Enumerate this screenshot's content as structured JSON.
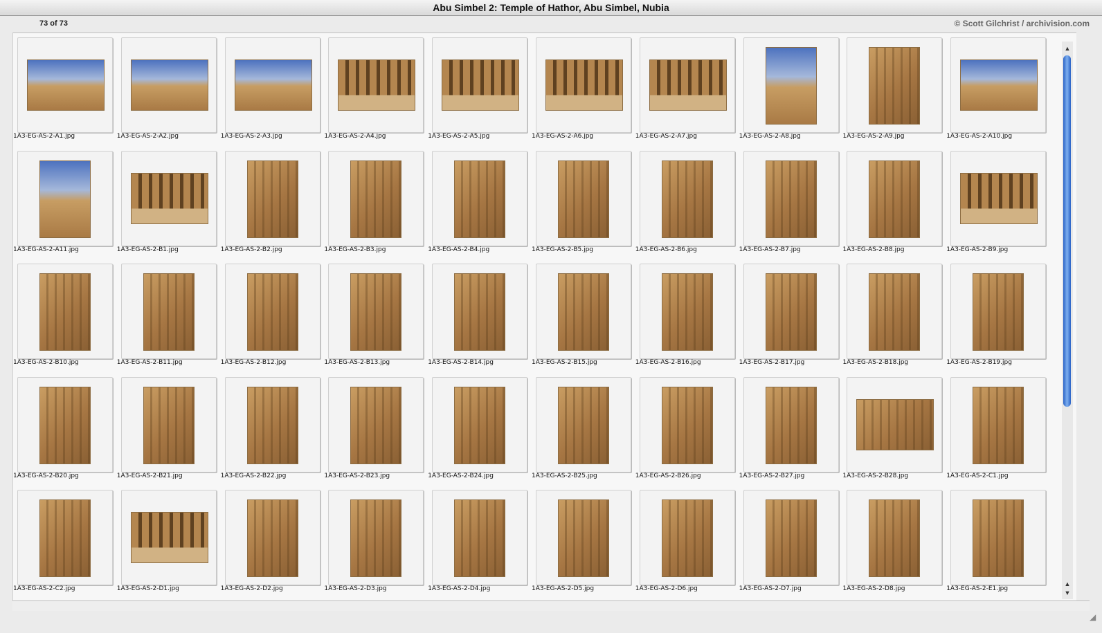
{
  "window": {
    "title": "Abu Simbel 2: Temple of Hathor, Abu Simbel, Nubia"
  },
  "toolbar": {
    "counter": "73 of 73",
    "copyright": "© Scott Gilchrist / archivision.com"
  },
  "thumbnails": [
    "1A3-EG-AS-2-A1.jpg",
    "1A3-EG-AS-2-A2.jpg",
    "1A3-EG-AS-2-A3.jpg",
    "1A3-EG-AS-2-A4.jpg",
    "1A3-EG-AS-2-A5.jpg",
    "1A3-EG-AS-2-A6.jpg",
    "1A3-EG-AS-2-A7.jpg",
    "1A3-EG-AS-2-A8.jpg",
    "1A3-EG-AS-2-A9.jpg",
    "1A3-EG-AS-2-A10.jpg",
    "1A3-EG-AS-2-A11.jpg",
    "1A3-EG-AS-2-B1.jpg",
    "1A3-EG-AS-2-B2.jpg",
    "1A3-EG-AS-2-B3.jpg",
    "1A3-EG-AS-2-B4.jpg",
    "1A3-EG-AS-2-B5.jpg",
    "1A3-EG-AS-2-B6.jpg",
    "1A3-EG-AS-2-B7.jpg",
    "1A3-EG-AS-2-B8.jpg",
    "1A3-EG-AS-2-B9.jpg",
    "1A3-EG-AS-2-B10.jpg",
    "1A3-EG-AS-2-B11.jpg",
    "1A3-EG-AS-2-B12.jpg",
    "1A3-EG-AS-2-B13.jpg",
    "1A3-EG-AS-2-B14.jpg",
    "1A3-EG-AS-2-B15.jpg",
    "1A3-EG-AS-2-B16.jpg",
    "1A3-EG-AS-2-B17.jpg",
    "1A3-EG-AS-2-B18.jpg",
    "1A3-EG-AS-2-B19.jpg",
    "1A3-EG-AS-2-B20.jpg",
    "1A3-EG-AS-2-B21.jpg",
    "1A3-EG-AS-2-B22.jpg",
    "1A3-EG-AS-2-B23.jpg",
    "1A3-EG-AS-2-B24.jpg",
    "1A3-EG-AS-2-B25.jpg",
    "1A3-EG-AS-2-B26.jpg",
    "1A3-EG-AS-2-B27.jpg",
    "1A3-EG-AS-2-B28.jpg",
    "1A3-EG-AS-2-C1.jpg",
    "1A3-EG-AS-2-C2.jpg",
    "1A3-EG-AS-2-D1.jpg",
    "1A3-EG-AS-2-D2.jpg",
    "1A3-EG-AS-2-D3.jpg",
    "1A3-EG-AS-2-D4.jpg",
    "1A3-EG-AS-2-D5.jpg",
    "1A3-EG-AS-2-D6.jpg",
    "1A3-EG-AS-2-D7.jpg",
    "1A3-EG-AS-2-D8.jpg",
    "1A3-EG-AS-2-E1.jpg"
  ]
}
